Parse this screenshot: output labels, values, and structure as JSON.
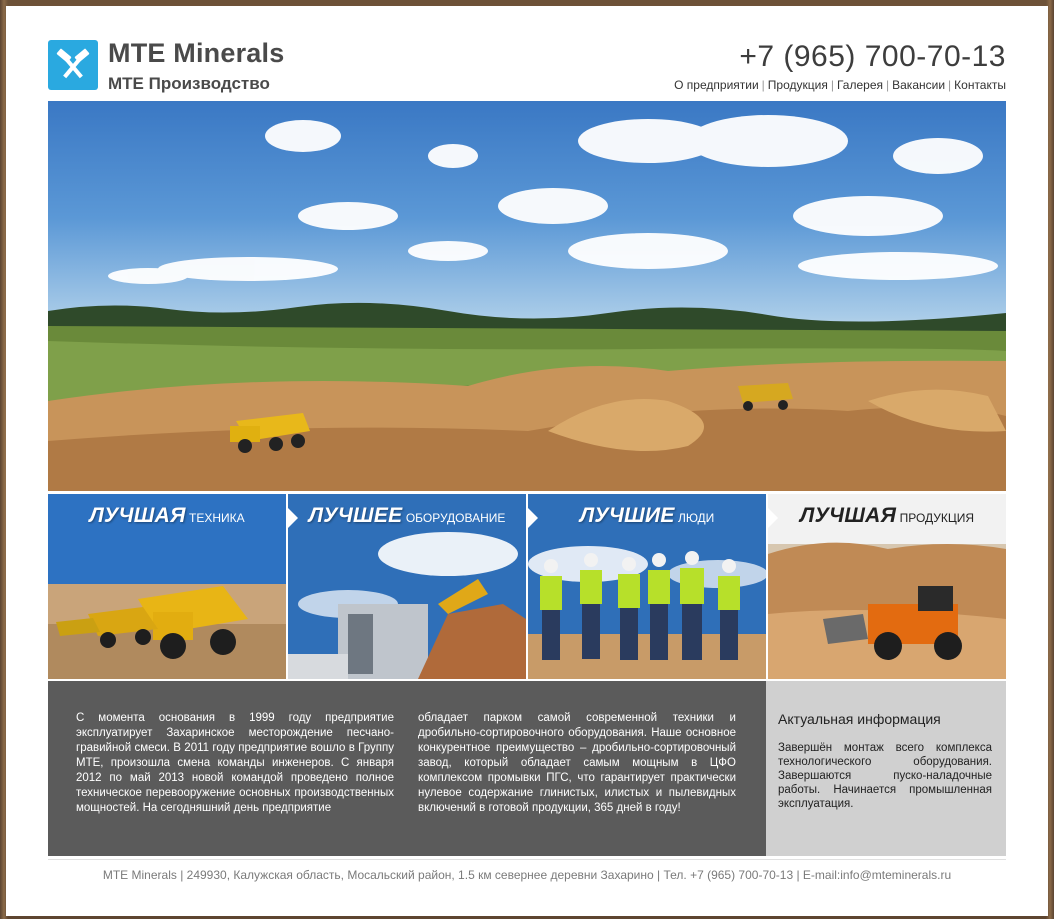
{
  "header": {
    "brand": "MTE Minerals",
    "brand_sub": "MTE Производство",
    "phone": "+7 (965) 700-70-13",
    "nav": [
      "О предприятии",
      "Продукция",
      "Галерея",
      "Вакансии",
      "Контакты"
    ]
  },
  "tiles": [
    {
      "big": "ЛУЧШАЯ",
      "small": "ТЕХНИКА"
    },
    {
      "big": "ЛУЧШЕЕ",
      "small": "ОБОРУДОВАНИЕ"
    },
    {
      "big": "ЛУЧШИЕ",
      "small": "ЛЮДИ"
    },
    {
      "big": "ЛУЧШАЯ",
      "small": "ПРОДУКЦИЯ"
    }
  ],
  "about": {
    "col1": "С момента основания в 1999 году предприятие эксплуатирует Захаринское месторождение песчано-гравийной смеси. В 2011 году предприятие вошло в Группу МТЕ, произошла смена команды инженеров. С января 2012 по май 2013 новой командой проведено полное техническое перевооружение основных производственных мощностей. На сегодняшний день предприятие",
    "col2": "обладает парком самой современной техники и дробильно-сортировочного оборудования. Наше основное конкурентное преимущество – дробильно-сортировочный завод, который обладает самым мощным в ЦФО комплексом промывки ПГС, что гарантирует практически нулевое содержание глинистых, илистых и пылевидных включений в готовой продукции, 365 дней в году!"
  },
  "news": {
    "title": "Актуальная информация",
    "text": "Завершён монтаж всего комплекса технологического оборудования. Завершаются пуско-наладочные работы. Начинается промышленная эксплуатация."
  },
  "footer": {
    "text": "MTE Minerals | 249930, Калужская область, Мосальский район, 1.5 км севернее деревни Захарино | Тел. +7 (965) 700-70-13 | E-mail:info@mteminerals.ru"
  },
  "colors": {
    "accent": "#2aa9e0",
    "info_bg": "#5b5b5b",
    "news_bg": "#d0d0d0"
  }
}
